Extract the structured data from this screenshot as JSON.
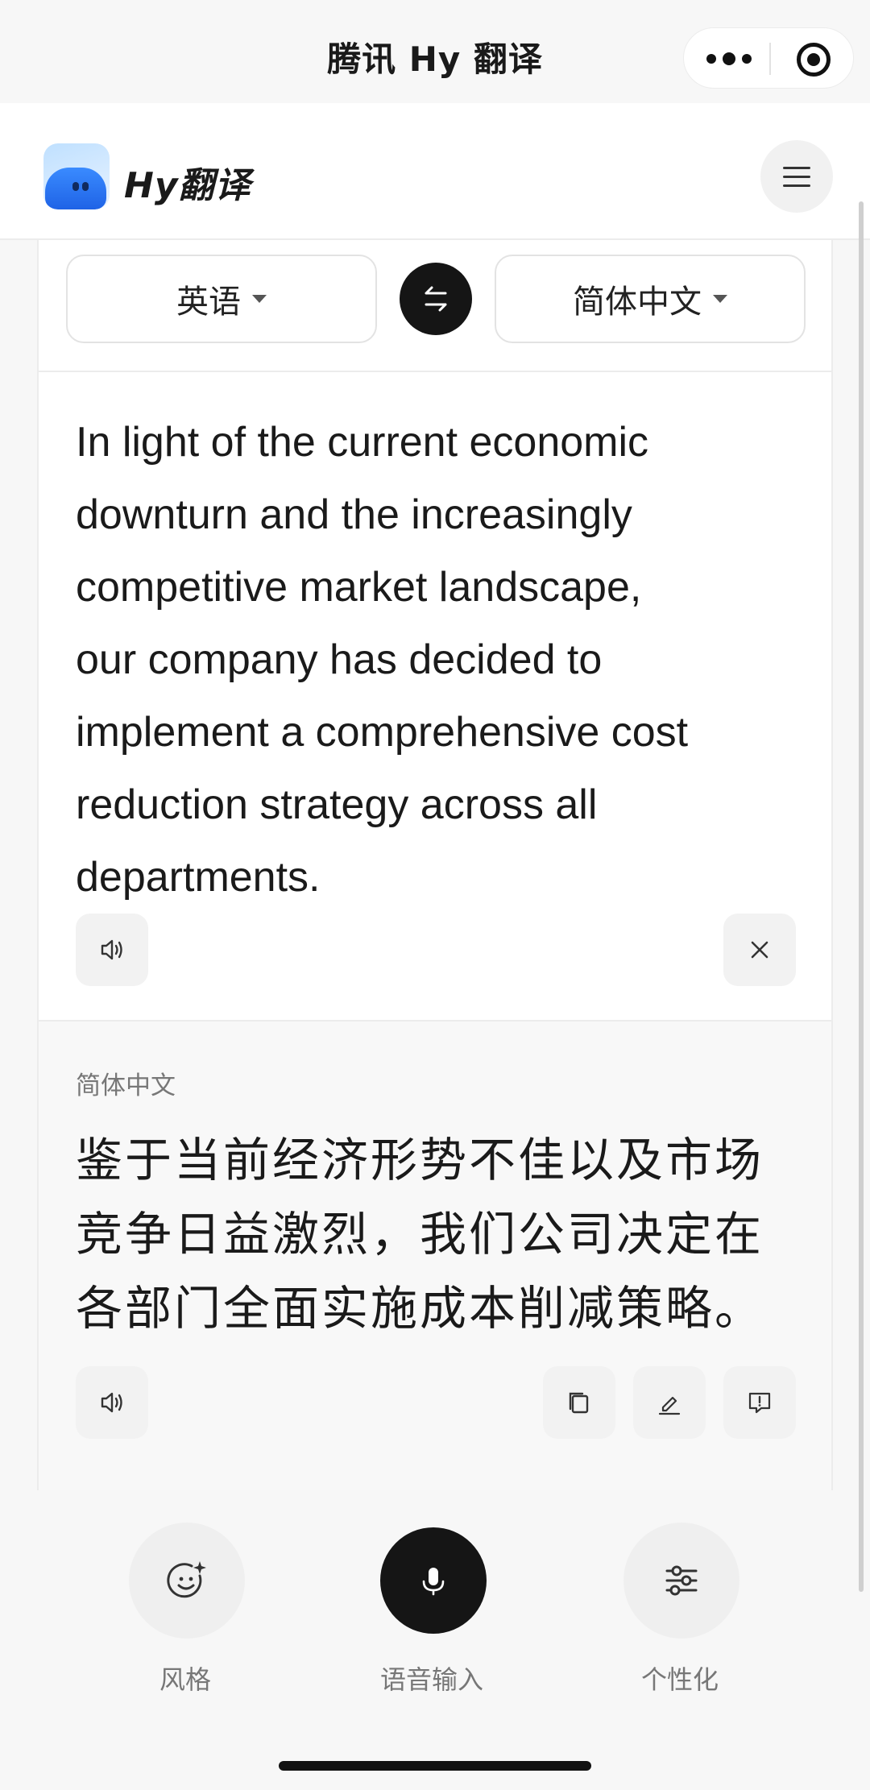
{
  "titlebar": {
    "title": "腾讯 Hy 翻译",
    "more_icon": "more-dots-icon",
    "close_icon": "target-close-icon"
  },
  "header": {
    "brand": "Hy翻译",
    "logo_icon": "hy-blob-logo",
    "menu_icon": "hamburger-icon"
  },
  "languages": {
    "source": "英语",
    "target": "简体中文",
    "swap_icon": "swap-arrows-icon"
  },
  "source": {
    "lines": [
      "In light of the current economic",
      "downturn and the increasingly",
      "competitive market landscape,",
      "our company has decided to",
      "implement a comprehensive cost",
      "reduction strategy across all",
      "departments."
    ]
  },
  "result": {
    "language_label": "简体中文",
    "lines": [
      "鉴于当前经济形势不佳以及市场",
      "竞争日益激烈，我们公司决定在",
      "各部门全面实施成本削减策略。"
    ]
  },
  "tools": {
    "style_label": "风格",
    "voice_label": "语音输入",
    "custom_label": "个性化"
  },
  "colors": {
    "dark_button": "#151515",
    "background": "#f7f7f7",
    "card": "#ffffff"
  }
}
